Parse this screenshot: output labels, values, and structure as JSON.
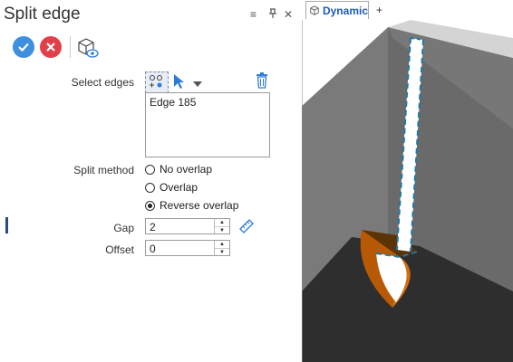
{
  "panel": {
    "title": "Split edge",
    "header_icons": [
      "menu-icon",
      "pin-icon",
      "close-icon"
    ],
    "header_glyphs": {
      "menu": "≡",
      "pin": "ᵖ",
      "close": "✕"
    },
    "toolbar": {
      "ok": {
        "glyph": "✓",
        "color": "#3d8fe0"
      },
      "cancel": {
        "glyph": "✕",
        "color": "#e0404a"
      },
      "preview_icon": "view-cube-icon"
    }
  },
  "form": {
    "select_edges_label": "Select edges",
    "edges": [
      "Edge 185"
    ],
    "split_method_label": "Split method",
    "split_options": [
      {
        "label": "No overlap",
        "selected": false
      },
      {
        "label": "Overlap",
        "selected": false
      },
      {
        "label": "Reverse overlap",
        "selected": true
      }
    ],
    "gap_label": "Gap",
    "gap_value": "2",
    "offset_label": "Offset",
    "offset_value": "0"
  },
  "viewport": {
    "tab_label": "Dynamic",
    "add_tab": "+"
  }
}
